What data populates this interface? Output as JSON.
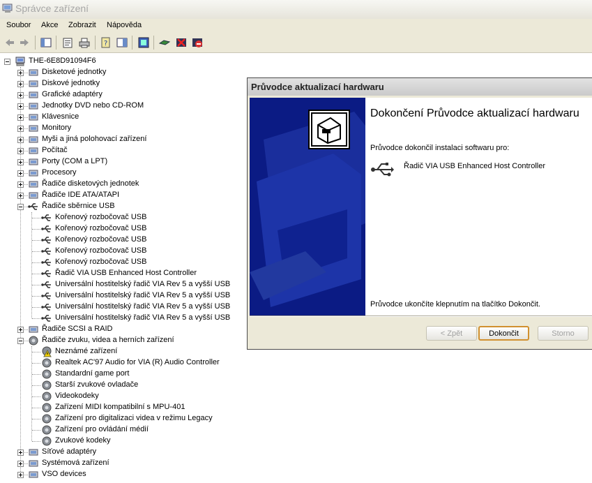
{
  "window": {
    "title": "Správce zařízení"
  },
  "menu": [
    "Soubor",
    "Akce",
    "Zobrazit",
    "Nápověda"
  ],
  "toolbar": [
    "back-icon",
    "forward-icon",
    "show-hide-tree-icon",
    "properties-icon",
    "print-icon",
    "help-icon",
    "action-pane-icon",
    "scan-hardware-icon",
    "update-driver-icon",
    "uninstall-icon",
    "disable-icon"
  ],
  "tree": {
    "root": "THE-6E8D91094F6",
    "items": [
      {
        "label": "Disketové jednotky",
        "icon": "floppy-drive-icon",
        "expanded": false
      },
      {
        "label": "Diskové jednotky",
        "icon": "disk-drive-icon",
        "expanded": false
      },
      {
        "label": "Grafické adaptéry",
        "icon": "display-adapter-icon",
        "expanded": false
      },
      {
        "label": "Jednotky DVD nebo CD-ROM",
        "icon": "cdrom-icon",
        "expanded": false
      },
      {
        "label": "Klávesnice",
        "icon": "keyboard-icon",
        "expanded": false
      },
      {
        "label": "Monitory",
        "icon": "monitor-icon",
        "expanded": false
      },
      {
        "label": "Myši a jiná polohovací zařízení",
        "icon": "mouse-icon",
        "expanded": false
      },
      {
        "label": "Počítač",
        "icon": "computer-icon",
        "expanded": false
      },
      {
        "label": "Porty (COM a LPT)",
        "icon": "port-icon",
        "expanded": false
      },
      {
        "label": "Procesory",
        "icon": "processor-icon",
        "expanded": false
      },
      {
        "label": "Řadiče disketových jednotek",
        "icon": "floppy-controller-icon",
        "expanded": false
      },
      {
        "label": "Řadiče IDE ATA/ATAPI",
        "icon": "ide-controller-icon",
        "expanded": false
      },
      {
        "label": "Řadiče sběrnice USB",
        "icon": "usb-icon",
        "expanded": true,
        "children": [
          "Kořenový rozbočovač USB",
          "Kořenový rozbočovač USB",
          "Kořenový rozbočovač USB",
          "Kořenový rozbočovač USB",
          "Kořenový rozbočovač USB",
          "Řadič VIA USB Enhanced Host Controller",
          "Universální hostitelský řadič VIA Rev 5 a vyšší USB",
          "Universální hostitelský řadič VIA Rev 5 a vyšší USB",
          "Universální hostitelský řadič VIA Rev 5 a vyšší USB",
          "Universální hostitelský řadič VIA Rev 5 a vyšší USB"
        ]
      },
      {
        "label": "Řadiče SCSI a RAID",
        "icon": "scsi-icon",
        "expanded": false
      },
      {
        "label": "Řadiče zvuku, videa a herních zařízení",
        "icon": "sound-icon",
        "expanded": true,
        "children": [
          "Neznámé zařízení",
          "Realtek AC'97 Audio for VIA (R) Audio Controller",
          "Standardní game port",
          "Starší zvukové ovladače",
          "Videokodeky",
          "Zařízení MIDI kompatibilní s MPU-401",
          "Zařízení pro digitalizaci videa v režimu Legacy",
          "Zařízení pro ovládání médií",
          "Zvukové kodeky"
        ]
      },
      {
        "label": "Síťové adaptéry",
        "icon": "network-adapter-icon",
        "expanded": false
      },
      {
        "label": "Systémová zařízení",
        "icon": "system-device-icon",
        "expanded": false
      },
      {
        "label": "VSO devices",
        "icon": "vso-device-icon",
        "expanded": false
      }
    ]
  },
  "dialog": {
    "title": "Průvodce aktualizací hardwaru",
    "heading": "Dokončení Průvodce aktualizací hardwaru",
    "intro": "Průvodce dokončil instalaci softwaru pro:",
    "device": "Řadič VIA USB Enhanced Host Controller",
    "footer": "Průvodce ukončíte klepnutím na tlačítko Dokončit.",
    "buttons": {
      "back": "< Zpět",
      "finish": "Dokončit",
      "cancel": "Storno"
    }
  },
  "colors": {
    "titlebar_text": "#a6a6a6",
    "dialog_side": "#0b1b84",
    "default_button_border": "#d1902f"
  }
}
